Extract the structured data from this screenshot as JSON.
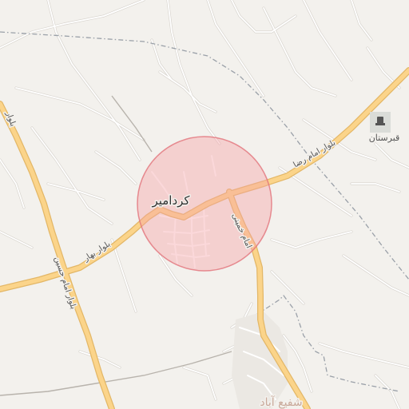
{
  "map": {
    "town_label": "کردامیر",
    "roads": {
      "imam_reza": "بلوار امام رضا",
      "bahar": "بلوار بهار",
      "imam_hossein": "بلوار امام حسین",
      "imam_khomeini": "امام خمینی",
      "top_left_road": "بلوار"
    },
    "cemetery_label": "قبرستان",
    "bottom_town_label": "شفیع آباد",
    "colors": {
      "background": "#f3f1ed",
      "major_road_fill": "#fbd48a",
      "major_road_casing": "#e3b767",
      "minor_road": "#ffffff",
      "minor_road_casing": "#d9d5cf",
      "boundary": "#9aa0a8",
      "highlight_fill": "#f6a3a8",
      "highlight_stroke": "#e2737b"
    },
    "icons": [
      "cemetery-icon"
    ]
  }
}
